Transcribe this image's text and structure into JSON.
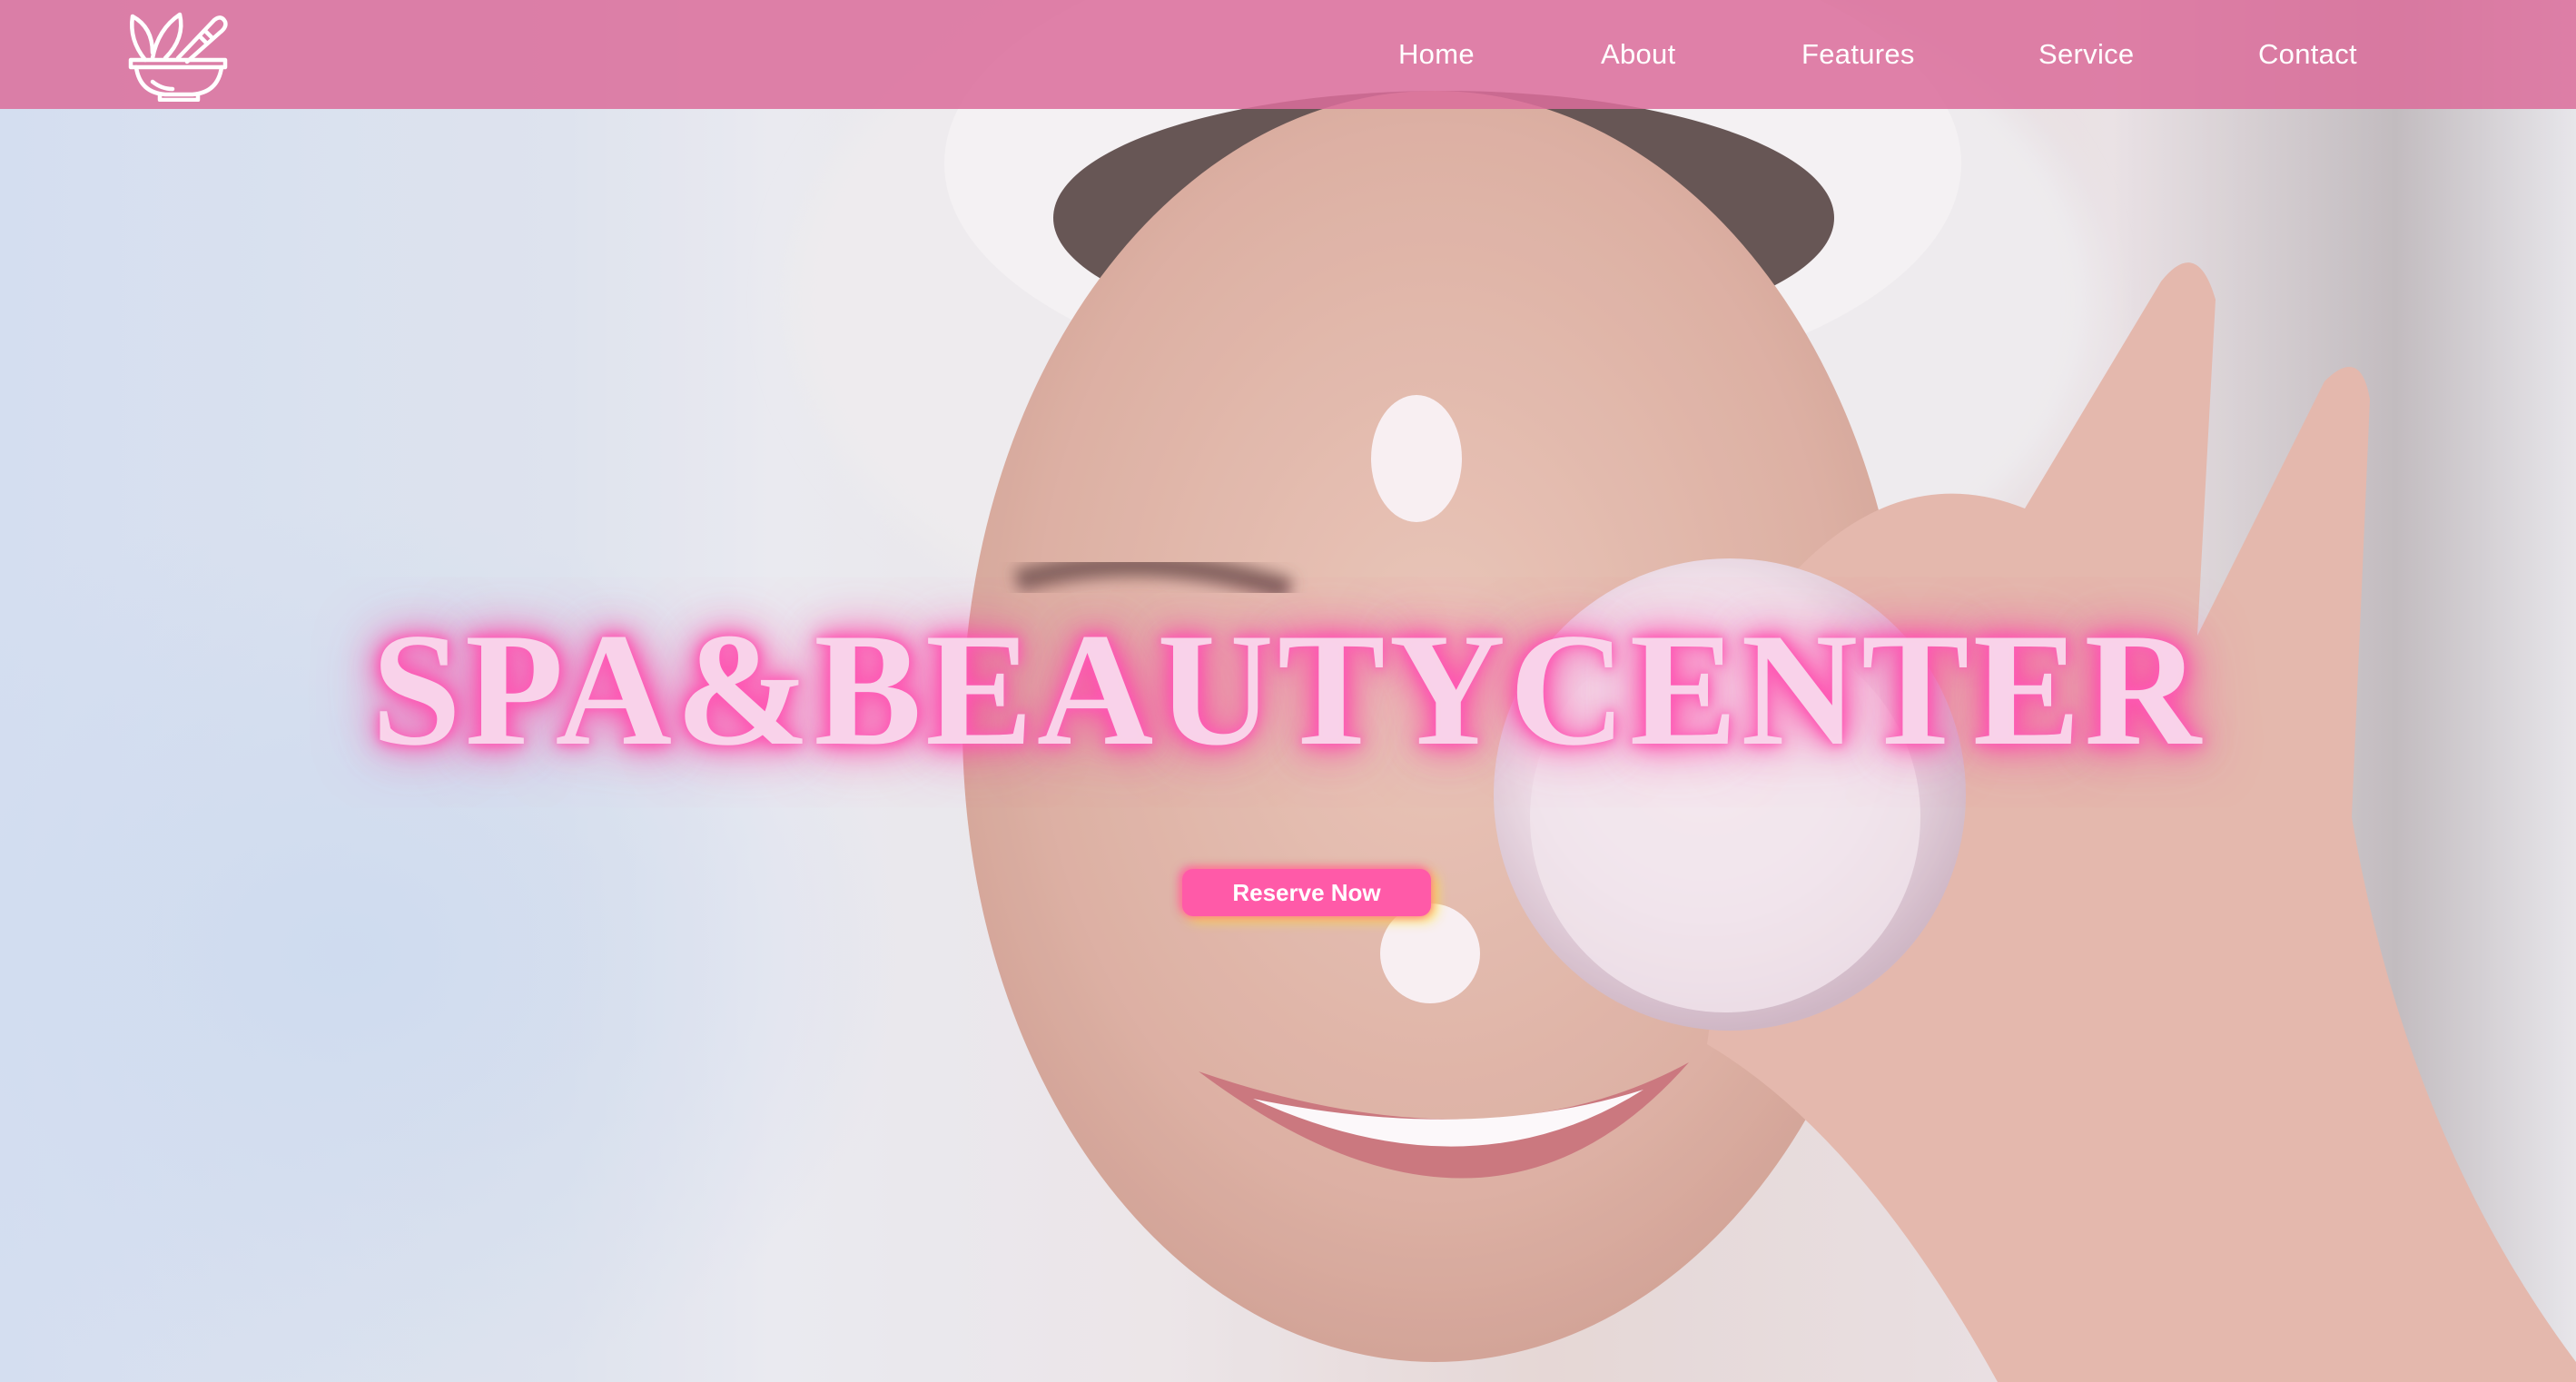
{
  "brand": {
    "logo_icon": "mortar-pestle-leaf-icon"
  },
  "nav": {
    "items": [
      {
        "label": "Home"
      },
      {
        "label": "About"
      },
      {
        "label": "Features"
      },
      {
        "label": "Service"
      },
      {
        "label": "Contact"
      }
    ]
  },
  "hero": {
    "headline": "SPA&BEAUTYCENTER",
    "cta_label": "Reserve Now",
    "photo_subject": "woman with towel on head holding cream jar over eye"
  },
  "colors": {
    "nav_background": "#db6e9b",
    "headline_glow": "#ff4fae",
    "cta_background": "#ff5aa8",
    "cta_glow": "#ffec28"
  }
}
